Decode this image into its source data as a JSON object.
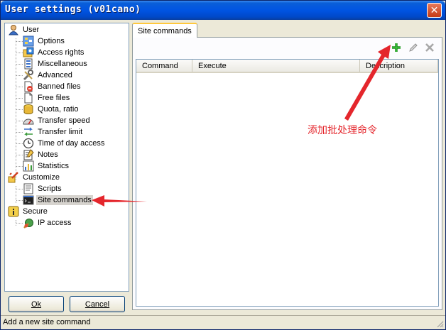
{
  "window": {
    "title": "User settings (v01cano)",
    "close_glyph": "✕"
  },
  "tree": {
    "items": [
      {
        "label": "User",
        "icon": "user-icon",
        "level": 0
      },
      {
        "label": "Options",
        "icon": "options-icon",
        "level": 1
      },
      {
        "label": "Access rights",
        "icon": "access-rights-icon",
        "level": 1
      },
      {
        "label": "Miscellaneous",
        "icon": "miscellaneous-icon",
        "level": 1
      },
      {
        "label": "Advanced",
        "icon": "advanced-icon",
        "level": 1
      },
      {
        "label": "Banned files",
        "icon": "banned-files-icon",
        "level": 1
      },
      {
        "label": "Free files",
        "icon": "free-files-icon",
        "level": 1
      },
      {
        "label": "Quota, ratio",
        "icon": "quota-icon",
        "level": 1
      },
      {
        "label": "Transfer speed",
        "icon": "transfer-speed-icon",
        "level": 1
      },
      {
        "label": "Transfer limit",
        "icon": "transfer-limit-icon",
        "level": 1
      },
      {
        "label": "Time of day access",
        "icon": "clock-icon",
        "level": 1
      },
      {
        "label": "Notes",
        "icon": "notes-icon",
        "level": 1
      },
      {
        "label": "Statistics",
        "icon": "statistics-icon",
        "level": 1
      },
      {
        "label": "Customize",
        "icon": "customize-icon",
        "level": 0
      },
      {
        "label": "Scripts",
        "icon": "scripts-icon",
        "level": 1
      },
      {
        "label": "Site commands",
        "icon": "terminal-icon",
        "level": 1,
        "selected": true
      },
      {
        "label": "Secure",
        "icon": "secure-icon",
        "level": 0
      },
      {
        "label": "IP access",
        "icon": "ip-access-icon",
        "level": 1
      }
    ]
  },
  "buttons": {
    "ok_label": "Ok",
    "cancel_label": "Cancel"
  },
  "tabs": [
    {
      "label": "Site commands",
      "active": true
    }
  ],
  "toolbar": {
    "add_icon": "plus-icon",
    "edit_icon": "pencil-icon",
    "delete_icon": "delete-x-icon"
  },
  "list": {
    "columns": [
      "Command",
      "Execute",
      "Description"
    ],
    "rows": []
  },
  "statusbar": {
    "text": "Add a new site command"
  },
  "annotation": {
    "text": "添加批处理命令",
    "color": "#e4262c"
  },
  "colors": {
    "title_bar": "#0054e3",
    "window_bg": "#ece9d8",
    "tab_highlight": "#ffc83c",
    "selection_bg": "#d6d3ce"
  }
}
